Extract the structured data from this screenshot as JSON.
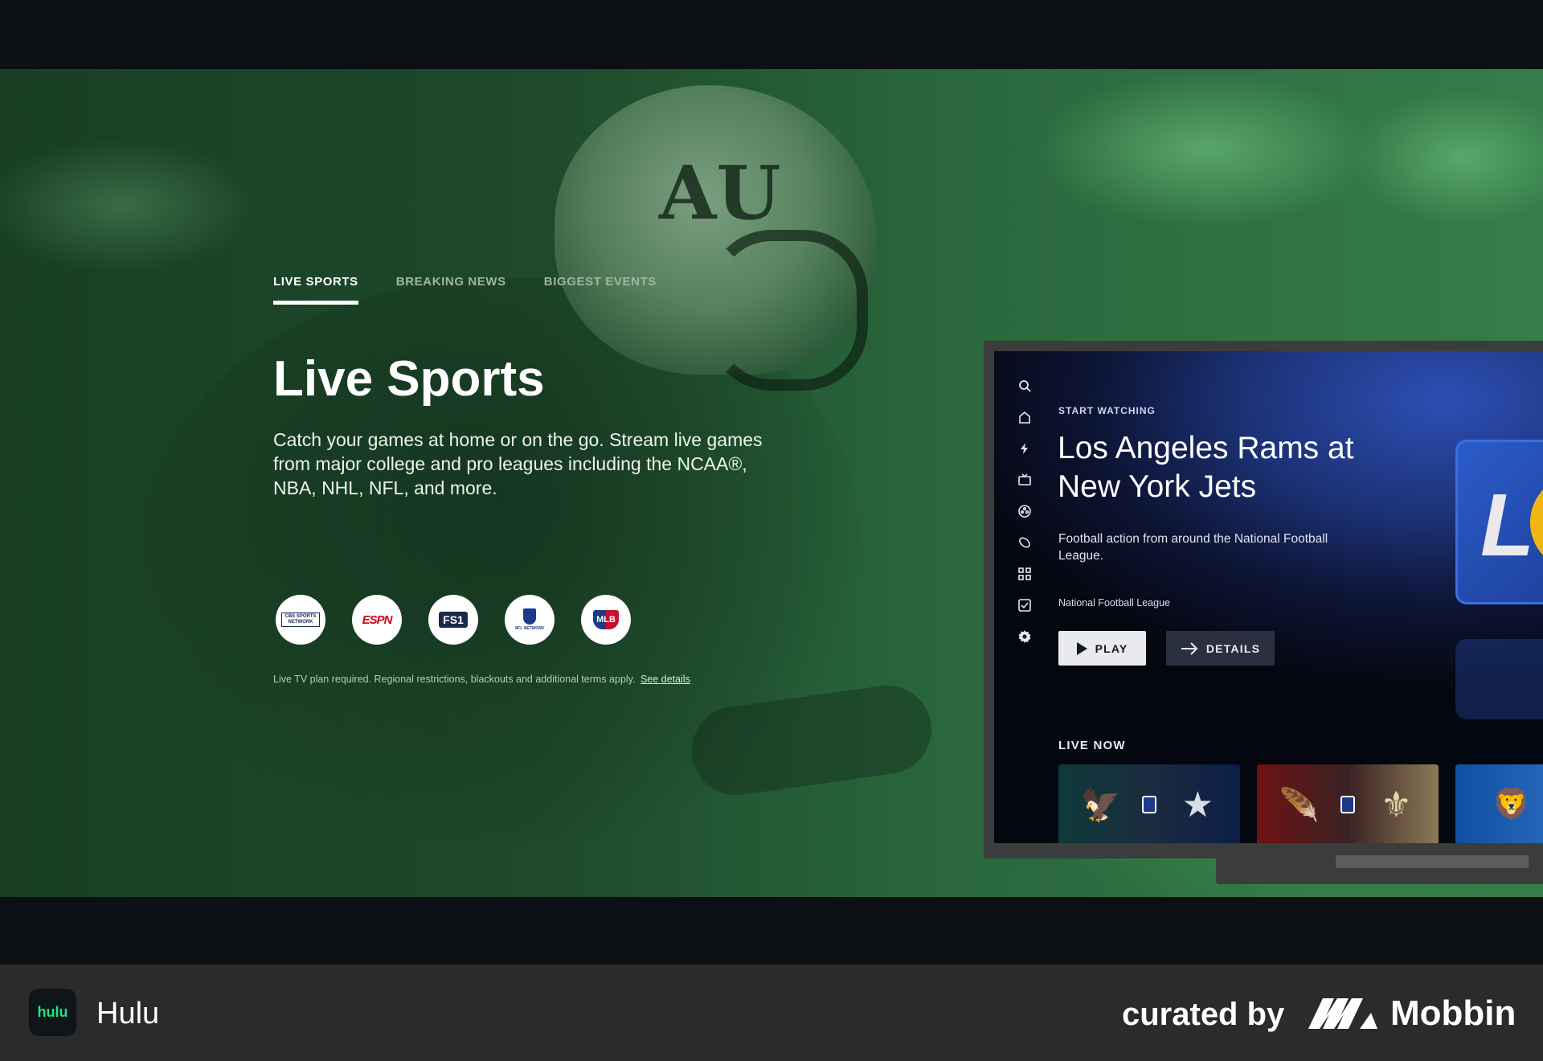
{
  "hero": {
    "tabs": [
      {
        "label": "LIVE SPORTS",
        "active": true
      },
      {
        "label": "BREAKING NEWS",
        "active": false
      },
      {
        "label": "BIGGEST EVENTS",
        "active": false
      }
    ],
    "headline": "Live Sports",
    "description": "Catch your games at home or on the go. Stream live games from major college and pro leagues including the NCAA®, NBA, NHL, NFL, and more.",
    "network_logos": [
      {
        "name": "CBS SPORTS NETWORK",
        "text": "CBS SPORTS NETWORK"
      },
      {
        "name": "ESPN",
        "text": "ESPN"
      },
      {
        "name": "FS1",
        "text": "FS1"
      },
      {
        "name": "NFL NETWORK",
        "text": "NFL NETWORK"
      },
      {
        "name": "MLB NETWORK",
        "text": "MLB"
      }
    ],
    "disclaimer": "Live TV plan required. Regional restrictions, blackouts and additional terms apply.",
    "disclaimer_link": "See details",
    "silhouette_logo": "AU"
  },
  "tv": {
    "sidebar_icons": [
      "search-icon",
      "home-icon",
      "lightning-icon",
      "tv-icon",
      "film-reel-icon",
      "sports-ball-icon",
      "grid-icon",
      "checkbox-icon",
      "gear-icon"
    ],
    "start_watching_label": "START WATCHING",
    "title": "Los Angeles Rams at New York Jets",
    "description": "Football action from around the National Football League.",
    "league": "National Football League",
    "play_label": "PLAY",
    "details_label": "DETAILS",
    "live_now_label": "LIVE NOW",
    "feature_tile_text": "L"
  },
  "footer": {
    "app_icon_text": "hulu",
    "app_name": "Hulu",
    "curated_by": "curated by",
    "brand": "Mobbin"
  },
  "colors": {
    "hulu_green": "#1ce783",
    "hero_green": "#21502f",
    "tv_blue": "#1c3277"
  }
}
